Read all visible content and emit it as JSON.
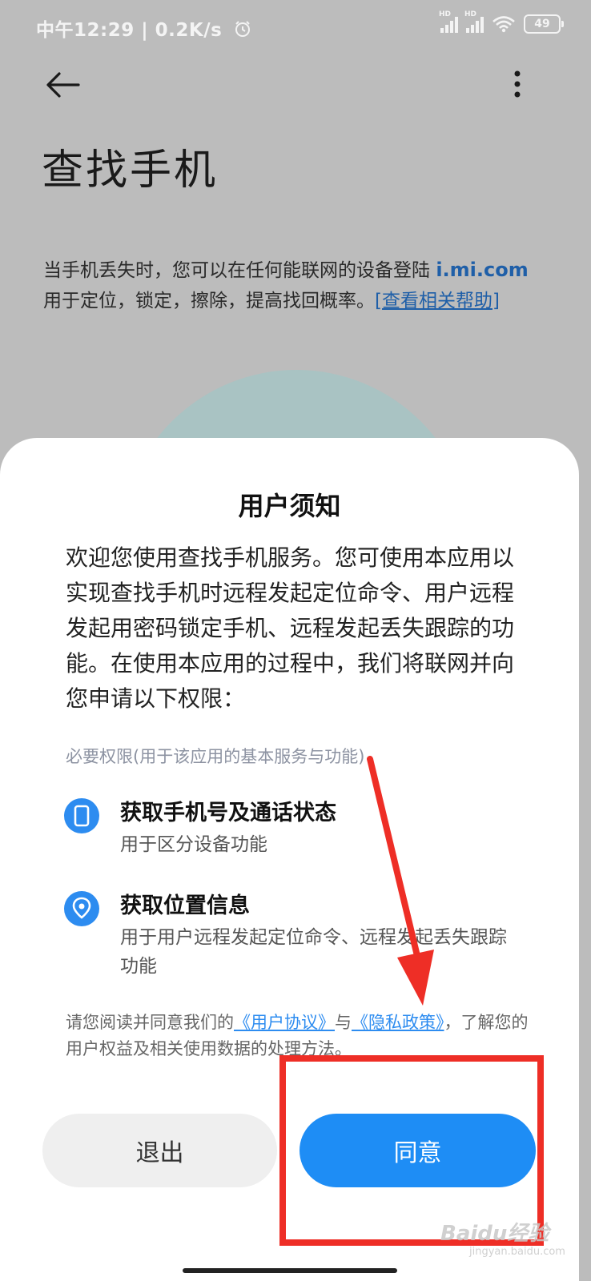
{
  "status_bar": {
    "time": "中午12:29",
    "speed": "0.2K/s",
    "hd_label": "HD",
    "battery": "49"
  },
  "page": {
    "title": "查找手机",
    "desc_line1": "当手机丢失时，您可以在任何能联网的设备登陆",
    "domain": "i.mi.com",
    "desc_line2": "用于定位，锁定，擦除，提高找回概率。",
    "help_link": "[查看相关帮助]"
  },
  "dialog": {
    "title": "用户须知",
    "intro": "欢迎您使用查找手机服务。您可使用本应用以实现查找手机时远程发起定位命令、用户远程发起用密码锁定手机、远程发起丢失跟踪的功能。在使用本应用的过程中，我们将联网并向您申请以下权限：",
    "permissions_header": "必要权限(用于该应用的基本服务与功能)",
    "permissions": [
      {
        "name": "获取手机号及通话状态",
        "desc": "用于区分设备功能",
        "icon": "phone-icon"
      },
      {
        "name": "获取位置信息",
        "desc": "用于用户远程发起定位命令、远程发起丢失跟踪功能",
        "icon": "location-pin-icon"
      }
    ],
    "agreement": {
      "prefix": "请您阅读并同意我们的",
      "user_agreement": "《用户协议》",
      "and": "与",
      "privacy_policy": "《隐私政策》",
      "suffix": "，了解您的用户权益及相关使用数据的处理方法。"
    },
    "exit_label": "退出",
    "agree_label": "同意"
  },
  "watermark": {
    "brand": "Baidu经验",
    "url": "jingyan.baidu.com"
  },
  "colors": {
    "accent": "#1e8df5",
    "annotation": "#ee2e26",
    "link": "#1f5fa8"
  }
}
